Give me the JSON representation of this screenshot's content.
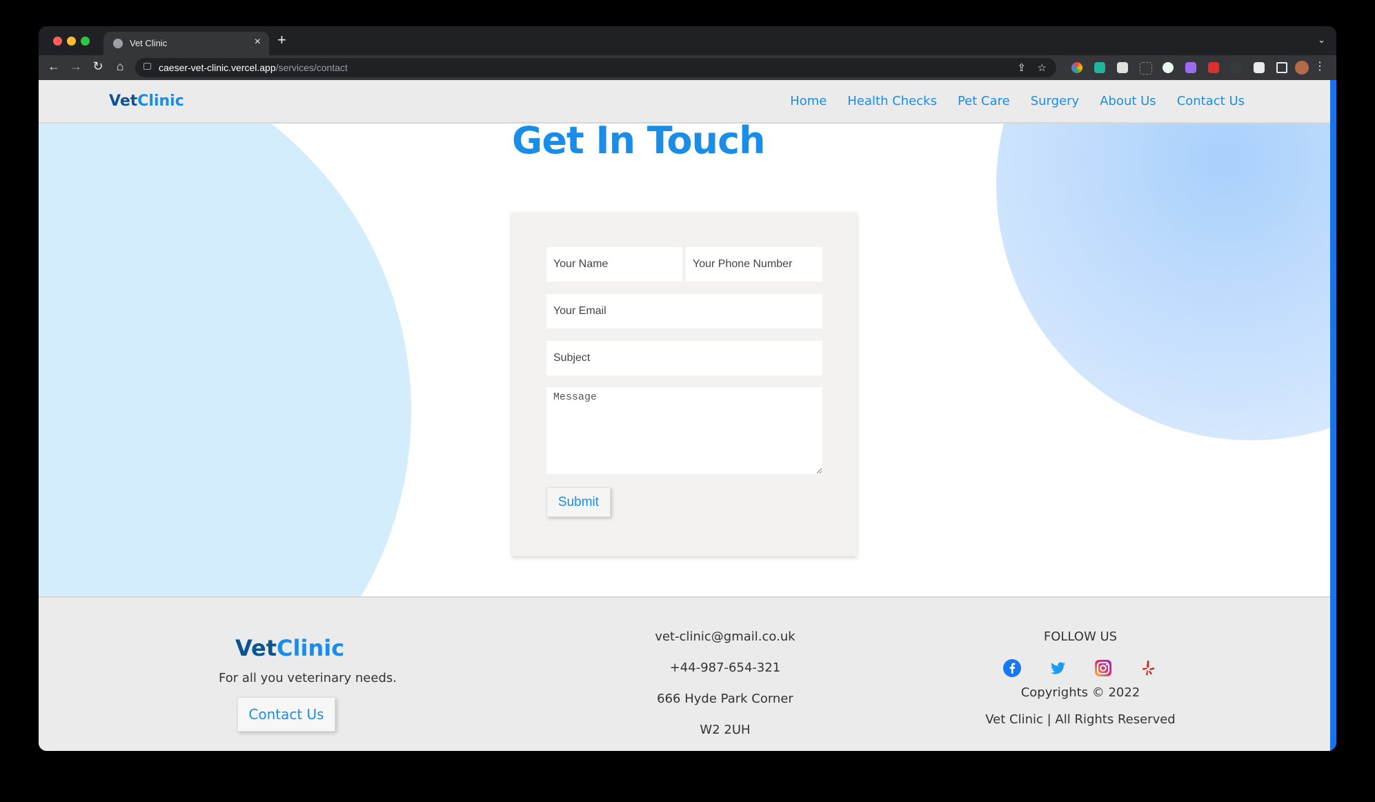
{
  "browser": {
    "tab_title": "Vet Clinic",
    "url_host": "caeser-vet-clinic.vercel.app",
    "url_path": "/services/contact"
  },
  "site": {
    "logo_part1": "Vet",
    "logo_part2": "Clinic",
    "nav": [
      "Home",
      "Health Checks",
      "Pet Care",
      "Surgery",
      "About Us",
      "Contact Us"
    ]
  },
  "contact": {
    "heading": "Get In Touch",
    "name_placeholder": "Your Name",
    "phone_placeholder": "Your Phone Number",
    "email_placeholder": "Your Email",
    "subject_placeholder": "Subject",
    "message_placeholder": "Message",
    "submit_label": "Submit"
  },
  "footer": {
    "logo_part1": "Vet",
    "logo_part2": "Clinic",
    "tagline": "For all you veterinary needs.",
    "contact_button": "Contact Us",
    "email": "vet-clinic@gmail.co.uk",
    "phone": "+44-987-654-321",
    "address1": "666 Hyde Park Corner",
    "address2": "W2 2UH",
    "follow_label": "FOLLOW US",
    "socials": [
      "facebook-icon",
      "twitter-icon",
      "instagram-icon",
      "yelp-icon"
    ],
    "copyright": "Copyrights © 2022",
    "rights": "Vet Clinic | All Rights Reserved"
  },
  "colors": {
    "brand_blue": "#1a8de8",
    "brand_dark": "#0b5394"
  }
}
